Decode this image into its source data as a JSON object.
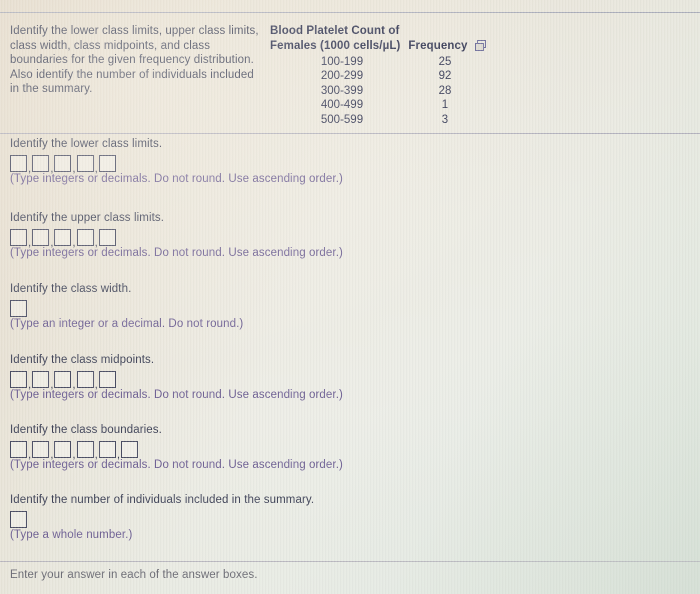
{
  "prompt": {
    "text": "Identify the lower class limits, upper class limits, class width, class midpoints, and class boundaries for the given frequency distribution. Also identify the number of individuals included in the summary."
  },
  "table": {
    "header_line1": "Blood Platelet Count of",
    "header_line2_col1": "Females (1000 cells/µL)",
    "header_line2_col2": "Frequency",
    "popout_icon": "popout-window-icon",
    "rows": [
      {
        "interval": "100-199",
        "frequency": "25"
      },
      {
        "interval": "200-299",
        "frequency": "92"
      },
      {
        "interval": "300-399",
        "frequency": "28"
      },
      {
        "interval": "400-499",
        "frequency": "1"
      },
      {
        "interval": "500-599",
        "frequency": "3"
      }
    ]
  },
  "questions": [
    {
      "id": "lower-class-limits",
      "label": "Identify the lower class limits.",
      "boxes": 5,
      "values": [
        "",
        "",
        "",
        "",
        ""
      ],
      "hint": "(Type integers or decimals. Do not round. Use ascending order.)"
    },
    {
      "id": "upper-class-limits",
      "label": "Identify the upper class limits.",
      "boxes": 5,
      "values": [
        "",
        "",
        "",
        "",
        ""
      ],
      "hint": "(Type integers or decimals. Do not round. Use ascending order.)"
    },
    {
      "id": "class-width",
      "label": "Identify the class width.",
      "boxes": 1,
      "values": [
        ""
      ],
      "hint": "(Type an integer or a decimal. Do not round.)"
    },
    {
      "id": "class-midpoints",
      "label": "Identify the class midpoints.",
      "boxes": 5,
      "values": [
        "",
        "",
        "",
        "",
        ""
      ],
      "hint": "(Type integers or decimals. Do not round. Use ascending order.)"
    },
    {
      "id": "class-boundaries",
      "label": "Identify the class boundaries.",
      "boxes": 6,
      "values": [
        "",
        "",
        "",
        "",
        "",
        ""
      ],
      "hint": "(Type integers or decimals. Do not round. Use ascending order.)"
    },
    {
      "id": "number-of-individuals",
      "label": "Identify the number of individuals included in the summary.",
      "boxes": 1,
      "values": [
        ""
      ],
      "hint": "(Type a whole number.)"
    }
  ],
  "footer": {
    "text": "Enter your answer in each of the answer boxes."
  },
  "colors": {
    "body_text": "#3e4257",
    "hint_text": "#6d5f93",
    "table_text": "#2f3350",
    "footer_text": "#6b6b74",
    "box_border": "#4a4d64",
    "rule": "#9fa2b4"
  },
  "layout": {
    "question_tops": [
      138,
      212,
      283,
      354,
      424,
      494
    ]
  }
}
